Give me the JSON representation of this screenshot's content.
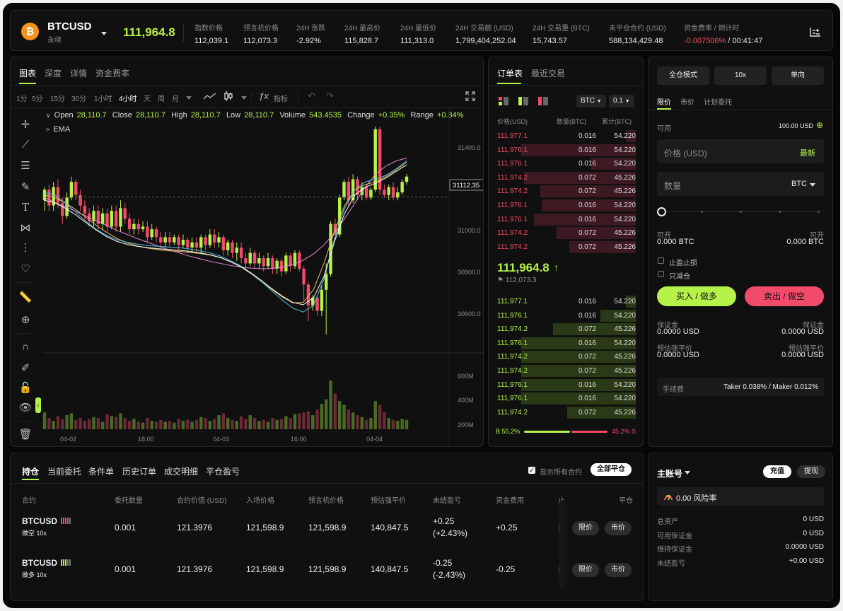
{
  "header": {
    "coin_glyph": "₿",
    "symbol": "BTCUSD",
    "subtitle": "永续",
    "last_price": "111,964.8",
    "stats": [
      {
        "label": "指数价格",
        "value": "112,039.1",
        "tone": "w"
      },
      {
        "label": "预言机价格",
        "value": "112,073.3",
        "tone": "w"
      },
      {
        "label": "24H 涨跌",
        "value": "-2.92%",
        "tone": "r"
      },
      {
        "label": "24H 最高价",
        "value": "115,828.7",
        "tone": "w"
      },
      {
        "label": "24H 最低价",
        "value": "111,313.0",
        "tone": "w"
      },
      {
        "label": "24H 交易额 (USD)",
        "value": "1,799,404,252.04",
        "tone": "w"
      },
      {
        "label": "24H 交易量 (BTC)",
        "value": "15,743.57",
        "tone": "w"
      },
      {
        "label": "未平仓合约 (USD)",
        "value": "588,134,429.48",
        "tone": "w"
      },
      {
        "label": "资金费率 / 倒计时",
        "value_a": "-0.007506%",
        "value_b": " / 00:41:47"
      }
    ],
    "settings_icon": "layout-settings-icon"
  },
  "chart_panel": {
    "tabs": [
      "图表",
      "深度",
      "详情",
      "资金费率"
    ],
    "intervals": [
      "1分",
      "5分",
      "15分",
      "30分",
      "1小时",
      "4小时",
      "天",
      "周",
      "月"
    ],
    "active_interval": "4小时",
    "indicator_label": "指标",
    "ohlc": {
      "open_label": "Open",
      "open": "28,110.7",
      "close_label": "Close",
      "close": "28,110.7",
      "high_label": "High",
      "high": "28,110.7",
      "low_label": "Low",
      "low": "28,110.7",
      "volume_label": "Volume",
      "volume": "543.4535",
      "change_label": "Change",
      "change": "+0.35%",
      "range_label": "Range",
      "range": "+0.84%"
    },
    "ema_label": "EMA",
    "price_ticks": [
      "31400.0",
      "31000.0",
      "30800.0",
      "30600.0"
    ],
    "current_price_tag": "31112.35",
    "volume_ticks": [
      "600M",
      "400M",
      "200M"
    ],
    "time_ticks": [
      "04-02",
      "18:00",
      "04-03",
      "16:00",
      "04-04"
    ]
  },
  "chart_data": {
    "type": "candlestick",
    "title": "",
    "xlabel": "",
    "ylabel": "",
    "ylim": [
      30520,
      31450
    ],
    "volume_ylim": [
      0,
      800
    ],
    "x_ticks": [
      "04-02",
      "18:00",
      "04-03",
      "16:00",
      "04-04"
    ],
    "y_ticks": [
      31400,
      31000,
      30800,
      30600
    ],
    "volume_ticks_M": [
      600,
      400,
      200
    ],
    "last_value": 31112.35,
    "candles": [
      [
        31100,
        31140,
        31150,
        31060,
        true,
        180
      ],
      [
        31140,
        31080,
        31160,
        31060,
        false,
        120
      ],
      [
        31080,
        31150,
        31170,
        31060,
        true,
        90
      ],
      [
        31150,
        31090,
        31180,
        31070,
        false,
        140
      ],
      [
        31090,
        31040,
        31110,
        31010,
        false,
        110
      ],
      [
        31040,
        31110,
        31130,
        31030,
        true,
        150
      ],
      [
        31110,
        31170,
        31190,
        31100,
        true,
        170
      ],
      [
        31170,
        31120,
        31180,
        31100,
        false,
        100
      ],
      [
        31120,
        31080,
        31140,
        31060,
        false,
        120
      ],
      [
        31080,
        31050,
        31100,
        31020,
        false,
        90
      ],
      [
        31050,
        31020,
        31070,
        31000,
        false,
        110
      ],
      [
        31020,
        31060,
        31080,
        31000,
        true,
        130
      ],
      [
        31060,
        31010,
        31080,
        30990,
        false,
        120
      ],
      [
        31010,
        31050,
        31070,
        30990,
        true,
        80
      ],
      [
        31050,
        31000,
        31070,
        30980,
        false,
        160
      ],
      [
        31000,
        31060,
        31080,
        30990,
        true,
        140
      ],
      [
        31060,
        31000,
        31080,
        30980,
        false,
        130
      ],
      [
        31000,
        31070,
        31100,
        30980,
        true,
        170
      ],
      [
        31070,
        31030,
        31090,
        31010,
        false,
        120
      ],
      [
        31030,
        30990,
        31050,
        30970,
        false,
        90
      ],
      [
        30990,
        31010,
        31030,
        30970,
        true,
        110
      ],
      [
        31010,
        30990,
        31030,
        30970,
        false,
        80
      ],
      [
        30990,
        31000,
        31020,
        30980,
        true,
        70
      ],
      [
        31000,
        30960,
        31020,
        30940,
        false,
        120
      ],
      [
        30960,
        30990,
        31010,
        30950,
        true,
        90
      ],
      [
        30990,
        30960,
        31000,
        30940,
        false,
        80
      ],
      [
        30960,
        30940,
        30980,
        30920,
        false,
        100
      ],
      [
        30940,
        30960,
        30980,
        30920,
        true,
        80
      ],
      [
        30960,
        30940,
        30980,
        30920,
        false,
        90
      ],
      [
        30940,
        30960,
        30970,
        30930,
        true,
        70
      ],
      [
        30960,
        30930,
        30970,
        30910,
        false,
        110
      ],
      [
        30930,
        30950,
        30970,
        30920,
        true,
        90
      ],
      [
        30950,
        30920,
        30960,
        30900,
        false,
        100
      ],
      [
        30920,
        30940,
        30960,
        30900,
        true,
        80
      ],
      [
        30940,
        30920,
        30960,
        30900,
        false,
        100
      ],
      [
        30920,
        30960,
        30970,
        30900,
        true,
        130
      ],
      [
        30960,
        30930,
        30970,
        30910,
        false,
        120
      ],
      [
        30930,
        30970,
        30990,
        30920,
        true,
        90
      ],
      [
        30970,
        30940,
        30990,
        30920,
        false,
        110
      ],
      [
        30940,
        30960,
        30980,
        30920,
        true,
        150
      ],
      [
        30960,
        30910,
        30970,
        30890,
        false,
        170
      ],
      [
        30910,
        30940,
        30950,
        30890,
        true,
        120
      ],
      [
        30940,
        30900,
        30950,
        30880,
        false,
        100
      ],
      [
        30900,
        30920,
        30940,
        30870,
        true,
        90
      ],
      [
        30920,
        30880,
        30940,
        30860,
        false,
        140
      ],
      [
        30880,
        30860,
        30900,
        30840,
        false,
        110
      ],
      [
        30860,
        30900,
        30920,
        30850,
        true,
        150
      ],
      [
        30900,
        30860,
        30910,
        30840,
        false,
        120
      ],
      [
        30860,
        30880,
        30900,
        30840,
        true,
        90
      ],
      [
        30880,
        30850,
        30890,
        30830,
        false,
        100
      ],
      [
        30850,
        30880,
        30900,
        30840,
        true,
        80
      ],
      [
        30880,
        30840,
        30890,
        30820,
        false,
        120
      ],
      [
        30840,
        30870,
        30880,
        30820,
        true,
        100
      ],
      [
        30870,
        30830,
        30880,
        30810,
        false,
        110
      ],
      [
        30830,
        30890,
        30900,
        30820,
        true,
        140
      ],
      [
        30890,
        30850,
        30900,
        30830,
        false,
        120
      ],
      [
        30850,
        30900,
        30910,
        30840,
        true,
        160
      ],
      [
        30900,
        30840,
        30910,
        30830,
        false,
        170
      ],
      [
        30840,
        30780,
        30850,
        30720,
        false,
        180
      ],
      [
        30780,
        30700,
        30790,
        30640,
        false,
        190
      ],
      [
        30700,
        30730,
        30740,
        30680,
        true,
        150
      ],
      [
        30730,
        30680,
        30740,
        30660,
        false,
        210
      ],
      [
        30680,
        30760,
        30780,
        30660,
        true,
        270
      ],
      [
        30760,
        30820,
        30860,
        30590,
        true,
        320
      ],
      [
        30820,
        31010,
        31020,
        30810,
        true,
        520
      ],
      [
        31010,
        30970,
        31030,
        30950,
        false,
        380
      ],
      [
        30970,
        31110,
        31120,
        30960,
        true,
        300
      ],
      [
        31110,
        31170,
        31180,
        31100,
        true,
        260
      ],
      [
        31170,
        31100,
        31190,
        31080,
        false,
        210
      ],
      [
        31100,
        31180,
        31200,
        31090,
        true,
        180
      ],
      [
        31180,
        31120,
        31190,
        31100,
        false,
        150
      ],
      [
        31120,
        31150,
        31170,
        31100,
        true,
        130
      ],
      [
        31150,
        31110,
        31160,
        31100,
        false,
        100
      ],
      [
        31110,
        31140,
        31150,
        31100,
        true,
        120
      ],
      [
        31140,
        31370,
        31380,
        31130,
        true,
        300
      ],
      [
        31370,
        31140,
        31380,
        31120,
        false,
        260
      ],
      [
        31140,
        31120,
        31160,
        31110,
        false,
        180
      ],
      [
        31120,
        31150,
        31160,
        31100,
        true,
        120
      ],
      [
        31150,
        31110,
        31170,
        31100,
        false,
        100
      ],
      [
        31110,
        31130,
        31150,
        31100,
        true,
        90
      ],
      [
        31130,
        31170,
        31180,
        31120,
        true,
        110
      ],
      [
        31170,
        31190,
        31200,
        31160,
        true,
        100
      ]
    ],
    "series": [
      {
        "color": "#e98bd8",
        "values": [
          31110,
          31092,
          31075,
          31058,
          31040,
          31022,
          31004,
          30986,
          30970,
          30954,
          30940,
          30926,
          30912,
          30900,
          30888,
          30878,
          30868,
          30860,
          30852,
          30846,
          30842,
          30840,
          30841,
          30846,
          30856,
          30872,
          30896,
          30930,
          30975,
          31030,
          31090,
          31150,
          31200,
          31230,
          31250,
          31260
        ]
      },
      {
        "color": "#f2c15c",
        "values": [
          31120,
          31110,
          31090,
          31065,
          31035,
          31005,
          30978,
          30955,
          30938,
          30926,
          30918,
          30912,
          30908,
          30906,
          30902,
          30898,
          30892,
          30882,
          30866,
          30846,
          30820,
          30790,
          30760,
          30732,
          30710,
          30712,
          30760,
          30860,
          30980,
          31080,
          31140,
          31160,
          31170,
          31190,
          31215,
          31245
        ]
      },
      {
        "color": "#4fc3e8",
        "values": [
          31130,
          31120,
          31090,
          31055,
          31020,
          30990,
          30966,
          30950,
          30940,
          30933,
          30928,
          30925,
          30922,
          30920,
          30915,
          30908,
          30900,
          30888,
          30870,
          30850,
          30822,
          30790,
          30755,
          30720,
          30690,
          30675,
          30700,
          30800,
          30950,
          31070,
          31140,
          31170,
          31180,
          31195,
          31220,
          31250
        ]
      },
      {
        "color": "#ffffff",
        "values": [
          31100,
          31090,
          31070,
          31045,
          31015,
          30987,
          30962,
          30944,
          30932,
          30925,
          30920,
          30916,
          30913,
          30910,
          30906,
          30900,
          30893,
          30882,
          30866,
          30847,
          30823,
          30794,
          30763,
          30735,
          30712,
          30703,
          30730,
          30810,
          30940,
          31050,
          31120,
          31150,
          31165,
          31185,
          31210,
          31235
        ]
      }
    ]
  },
  "orderbook": {
    "tabs": [
      "订单表",
      "最近交易"
    ],
    "unit_select": "BTC",
    "step_select": "0.1",
    "headers": [
      "价格(USD)",
      "数量(BTC)",
      "累计(BTC)"
    ],
    "asks": [
      {
        "price": "111,977.1",
        "qty": "0.016",
        "total": "54.220",
        "depth": 0.08
      },
      {
        "price": "111,976.1",
        "qty": "0.016",
        "total": "54.220",
        "depth": 0.9
      },
      {
        "price": "111,976.1",
        "qty": "0.016",
        "total": "54.220",
        "depth": 0.35
      },
      {
        "price": "111,974.2",
        "qty": "0.072",
        "total": "45.226",
        "depth": 0.88
      },
      {
        "price": "111,974.2",
        "qty": "0.072",
        "total": "45.226",
        "depth": 0.75
      },
      {
        "price": "111,976.1",
        "qty": "0.016",
        "total": "54.220",
        "depth": 0.74
      },
      {
        "price": "111,976.1",
        "qty": "0.016",
        "total": "54.220",
        "depth": 0.8
      },
      {
        "price": "111,974.2",
        "qty": "0.072",
        "total": "45.226",
        "depth": 0.62
      },
      {
        "price": "111,974.2",
        "qty": "0.072",
        "total": "45.226",
        "depth": 0.52
      }
    ],
    "mid_price": "111,964.8",
    "mid_arrow": "↑",
    "mark_price": "112,073.3",
    "bids": [
      {
        "price": "111,977.1",
        "qty": "0.016",
        "total": "54.220",
        "depth": 0.08
      },
      {
        "price": "111,976.1",
        "qty": "0.016",
        "total": "54.220",
        "depth": 0.28
      },
      {
        "price": "111,974.2",
        "qty": "0.072",
        "total": "45.226",
        "depth": 0.65
      },
      {
        "price": "111,976.1",
        "qty": "0.016",
        "total": "54.220",
        "depth": 0.9
      },
      {
        "price": "111,974.2",
        "qty": "0.072",
        "total": "45.226",
        "depth": 0.9
      },
      {
        "price": "111,974.2",
        "qty": "0.072",
        "total": "45.226",
        "depth": 0.9
      },
      {
        "price": "111,976.1",
        "qty": "0.016",
        "total": "54.220",
        "depth": 0.9
      },
      {
        "price": "111,976.1",
        "qty": "0.016",
        "total": "54.220",
        "depth": 0.9
      },
      {
        "price": "111,974.2",
        "qty": "0.072",
        "total": "45.226",
        "depth": 0.54
      }
    ],
    "ratio_buy_label": "B",
    "ratio_buy": "55.2%",
    "ratio_sell": "45.2%",
    "ratio_sell_label": "S",
    "ratio_buy_value": 0.552
  },
  "trade": {
    "margin_mode": "全仓模式",
    "leverage": "10x",
    "position_mode": "单向",
    "order_tabs": [
      "限价",
      "市价",
      "计划委托"
    ],
    "available_label": "可用",
    "available_value": "100.00 USD",
    "price_placeholder": "价格 (USD)",
    "price_latest": "最新",
    "qty_placeholder": "数量",
    "qty_unit": "BTC",
    "slider_value": 0,
    "open_left_label": "可开",
    "open_left_value": "0.000 BTC",
    "open_right_label": "可开",
    "open_right_value": "0.000 BTC",
    "tp_sl": "止盈止损",
    "reduce_only": "只减仓",
    "buy_label": "买入 / 做多",
    "sell_label": "卖出 / 做空",
    "margin_label": "保证金",
    "margin_left": "0.0000 USD",
    "margin_right": "0.0000 USD",
    "liq_label": "预估强平价",
    "liq_left": "0.0000 USD",
    "liq_right": "0.0000 USD",
    "fee_label": "手续费",
    "fee_value": "Taker 0.038% / Maker 0.012%"
  },
  "positions": {
    "tabs": [
      "持仓",
      "当前委托",
      "条件单",
      "历史订单",
      "成交明细",
      "平仓盈亏"
    ],
    "show_all": "显示所有合约",
    "close_all": "全部平仓",
    "headers": [
      "合约",
      "委托数量",
      "合约价值 (USD)",
      "入场价格",
      "预言机价格",
      "预估强平价",
      "未结盈亏",
      "资金费用",
      "止",
      "平仓"
    ],
    "rows": [
      {
        "symbol": "BTCUSD",
        "side": "做空 10x",
        "side_tone": "r",
        "qty": "0.001",
        "value": "121.3976",
        "entry": "121,598.9",
        "oracle": "121,598.9",
        "liq": "140,847.5",
        "pnl1": "+0.25",
        "pnl2": "(+2.43%)",
        "pnl_tone": "g",
        "fund": "+0.25",
        "fund_tone": "g",
        "limit": "限价",
        "market": "市价"
      },
      {
        "symbol": "BTCUSD",
        "side": "做多 10x",
        "side_tone": "g",
        "qty": "0.001",
        "value": "121.3976",
        "entry": "121,598.9",
        "oracle": "121,598.9",
        "liq": "140,847.5",
        "pnl1": "-0.25",
        "pnl2": "(-2.43%)",
        "pnl_tone": "r",
        "fund": "-0.25",
        "fund_tone": "r",
        "limit": "限价",
        "market": "市价"
      }
    ]
  },
  "account": {
    "title": "主账号",
    "deposit": "充值",
    "withdraw": "提现",
    "risk_value": "0.00",
    "risk_label": "风险率",
    "items": [
      {
        "label": "总资产",
        "value": "0 USD",
        "tone": "w"
      },
      {
        "label": "可用保证金",
        "value": "0 USD",
        "tone": "w"
      },
      {
        "label": "维持保证金",
        "value": "0.0000 USD",
        "tone": "w"
      },
      {
        "label": "未结盈亏",
        "value": "+0.00 USD",
        "tone": "g"
      }
    ]
  }
}
